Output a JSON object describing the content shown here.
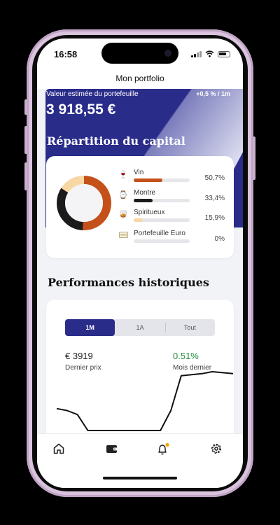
{
  "status_bar": {
    "time": "16:58"
  },
  "nav": {
    "title": "Mon portfolio"
  },
  "portfolio": {
    "value_label": "Valeur estimée du portefeuille",
    "change": "+0,5 % / 1m",
    "amount": "3 918,55 €"
  },
  "allocation": {
    "title": "Répartition du capital",
    "items": [
      {
        "name": "Vin",
        "pct_text": "50,7%",
        "value": 50.7,
        "color": "#c4511a",
        "icon": "wine-glass-icon"
      },
      {
        "name": "Montre",
        "pct_text": "33,4%",
        "value": 33.4,
        "color": "#1b1b1b",
        "icon": "watch-icon"
      },
      {
        "name": "Spiritueux",
        "pct_text": "15,9%",
        "value": 15.9,
        "color": "#f7d7a4",
        "icon": "whisky-glass-icon"
      },
      {
        "name": "Portefeuille Euro",
        "pct_text": "0%",
        "value": 0,
        "color": "#d8d8dc",
        "icon": "banknote-icon"
      }
    ]
  },
  "performance": {
    "title": "Performances historiques",
    "tabs": [
      "1M",
      "1A",
      "Tout"
    ],
    "active_tab": "1M",
    "price": "€ 3919",
    "price_label": "Dernier prix",
    "change": "0.51%",
    "change_label": "Mois dernier",
    "change_color": "#1f8a3c"
  },
  "chart_data": {
    "type": "line",
    "title": "",
    "xlabel": "",
    "ylabel": "",
    "series": [
      {
        "values": [
          62,
          60,
          56,
          40,
          40,
          40,
          40,
          40,
          40,
          40,
          40,
          60,
          95,
          96,
          97,
          99,
          98,
          97
        ]
      }
    ]
  },
  "tabbar": {
    "items": [
      {
        "icon": "home-icon"
      },
      {
        "icon": "wallet-icon",
        "active": true
      },
      {
        "icon": "bell-icon",
        "badge": true
      },
      {
        "icon": "settings-gear-icon"
      }
    ]
  },
  "colors": {
    "brand": "#2a2c8a",
    "notification_badge": "#f0a500"
  }
}
